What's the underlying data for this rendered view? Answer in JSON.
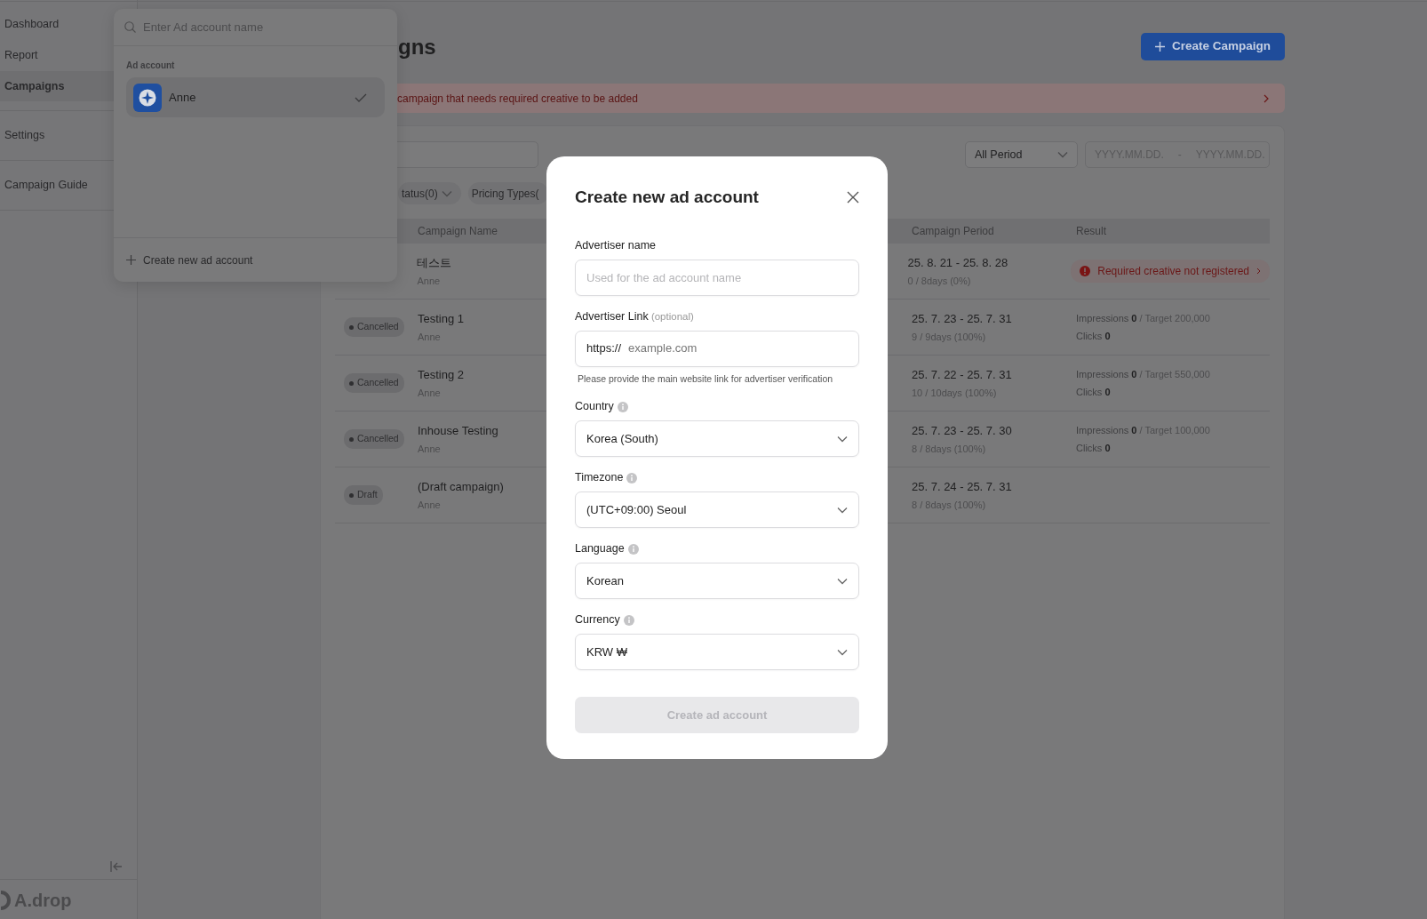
{
  "sidebar": {
    "sections": [
      {
        "items": [
          {
            "label": "Dashboard",
            "selected": false
          },
          {
            "label": "Report",
            "selected": false
          },
          {
            "label": "Campaigns",
            "selected": true
          }
        ]
      },
      {
        "items": [
          {
            "label": "Settings",
            "selected": false
          }
        ]
      },
      {
        "items": [
          {
            "label": "Campaign Guide",
            "selected": false
          }
        ]
      }
    ],
    "logo": "A.drop"
  },
  "page": {
    "title": "gns",
    "create_button": "Create Campaign",
    "alert": "campaign that needs required creative to be added",
    "filters": {
      "chips": [
        {
          "label": "tatus(0)"
        },
        {
          "label": "Pricing Types("
        }
      ],
      "period": "All Period",
      "date_from_placeholder": "YYYY.MM.DD.",
      "date_separator": "-",
      "date_to_placeholder": "YYYY.MM.DD."
    },
    "table": {
      "columns": [
        "Campaign Name",
        "Campaign Period",
        "Result"
      ],
      "rows": [
        {
          "name": "테스트",
          "owner": "Anne",
          "period": "25. 8. 21 - 25. 8. 28",
          "progress": "0 / 8days (0%)",
          "result": {
            "kind": "warning",
            "text": "Required creative not registered"
          }
        },
        {
          "status": "Cancelled",
          "name": "Testing 1",
          "owner": "Anne",
          "period": "25. 7. 23 - 25. 7. 31",
          "progress": "9 / 9days (100%)",
          "result": {
            "kind": "metrics",
            "impressions": "Impressions **0**",
            "target": "/ Target 200,000",
            "clicks": "Clicks **0**"
          }
        },
        {
          "status": "Cancelled",
          "name": "Testing 2",
          "owner": "Anne",
          "period": "25. 7. 22 - 25. 7. 31",
          "progress": "10 / 10days (100%)",
          "result": {
            "kind": "metrics",
            "impressions": "Impressions **0**",
            "target": "/ Target 550,000",
            "clicks": "Clicks **0**"
          }
        },
        {
          "status": "Cancelled",
          "name": "Inhouse Testing",
          "owner": "Anne",
          "period": "25. 7. 23 - 25. 7. 30",
          "progress": "8 / 8days (100%)",
          "result": {
            "kind": "metrics",
            "impressions": "Impressions **0**",
            "target": "/ Target 100,000",
            "clicks": "Clicks **0**"
          }
        },
        {
          "status": "Draft",
          "name": "(Draft campaign)",
          "owner": "Anne",
          "period": "25. 7. 24 - 25. 7. 31",
          "progress": "8 / 8days (100%)"
        }
      ]
    }
  },
  "account_menu": {
    "search_placeholder": "Enter Ad account name",
    "section_label": "Ad account",
    "accounts": [
      {
        "name": "Anne",
        "selected": true
      }
    ],
    "create_label": "Create new ad account"
  },
  "modal": {
    "title": "Create new ad account",
    "fields": [
      {
        "kind": "text",
        "label": "Advertiser name",
        "placeholder": "Used for the ad account name"
      },
      {
        "kind": "link",
        "label": "Advertiser Link",
        "optional": "(optional)",
        "prefix": "https://",
        "placeholder": "example.com",
        "help": "Please provide the main website link for advertiser verification"
      },
      {
        "kind": "select",
        "label": "Country",
        "info": true,
        "value": "Korea (South)"
      },
      {
        "kind": "select",
        "label": "Timezone",
        "info": true,
        "value": "(UTC+09:00) Seoul"
      },
      {
        "kind": "select",
        "label": "Language",
        "info": true,
        "value": "Korean"
      },
      {
        "kind": "select",
        "label": "Currency",
        "info": true,
        "value": "KRW ₩"
      }
    ],
    "submit": {
      "label": "Create ad account",
      "disabled": true
    }
  }
}
